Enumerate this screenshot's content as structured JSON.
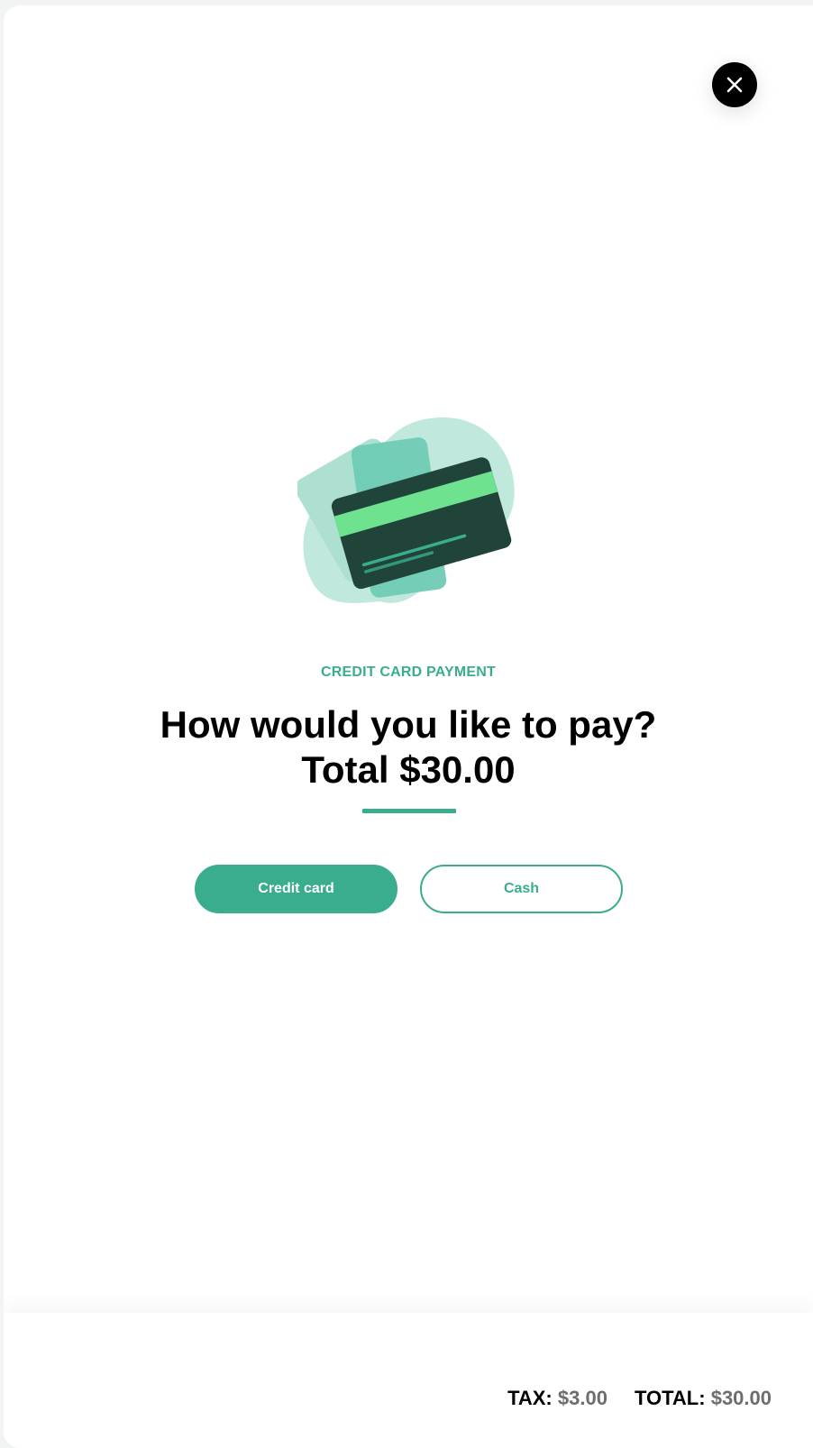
{
  "colors": {
    "accent": "#3aad8e",
    "card_dark": "#20443a",
    "card_stripe": "#6ee28e",
    "blob_light": "#c1e8dd",
    "blob_mid": "#6fcbb4"
  },
  "close_button": {
    "icon": "close-icon"
  },
  "illustration": {
    "icon": "credit-card-icon"
  },
  "payment": {
    "eyebrow": "CREDIT CARD PAYMENT",
    "headline_line1": "How would you like to pay?",
    "headline_line2": "Total $30.00"
  },
  "options": {
    "credit_card_label": "Credit card",
    "cash_label": "Cash"
  },
  "footer": {
    "tax_label": "TAX:",
    "tax_value": "$3.00",
    "total_label": "TOTAL:",
    "total_value": "$30.00"
  }
}
